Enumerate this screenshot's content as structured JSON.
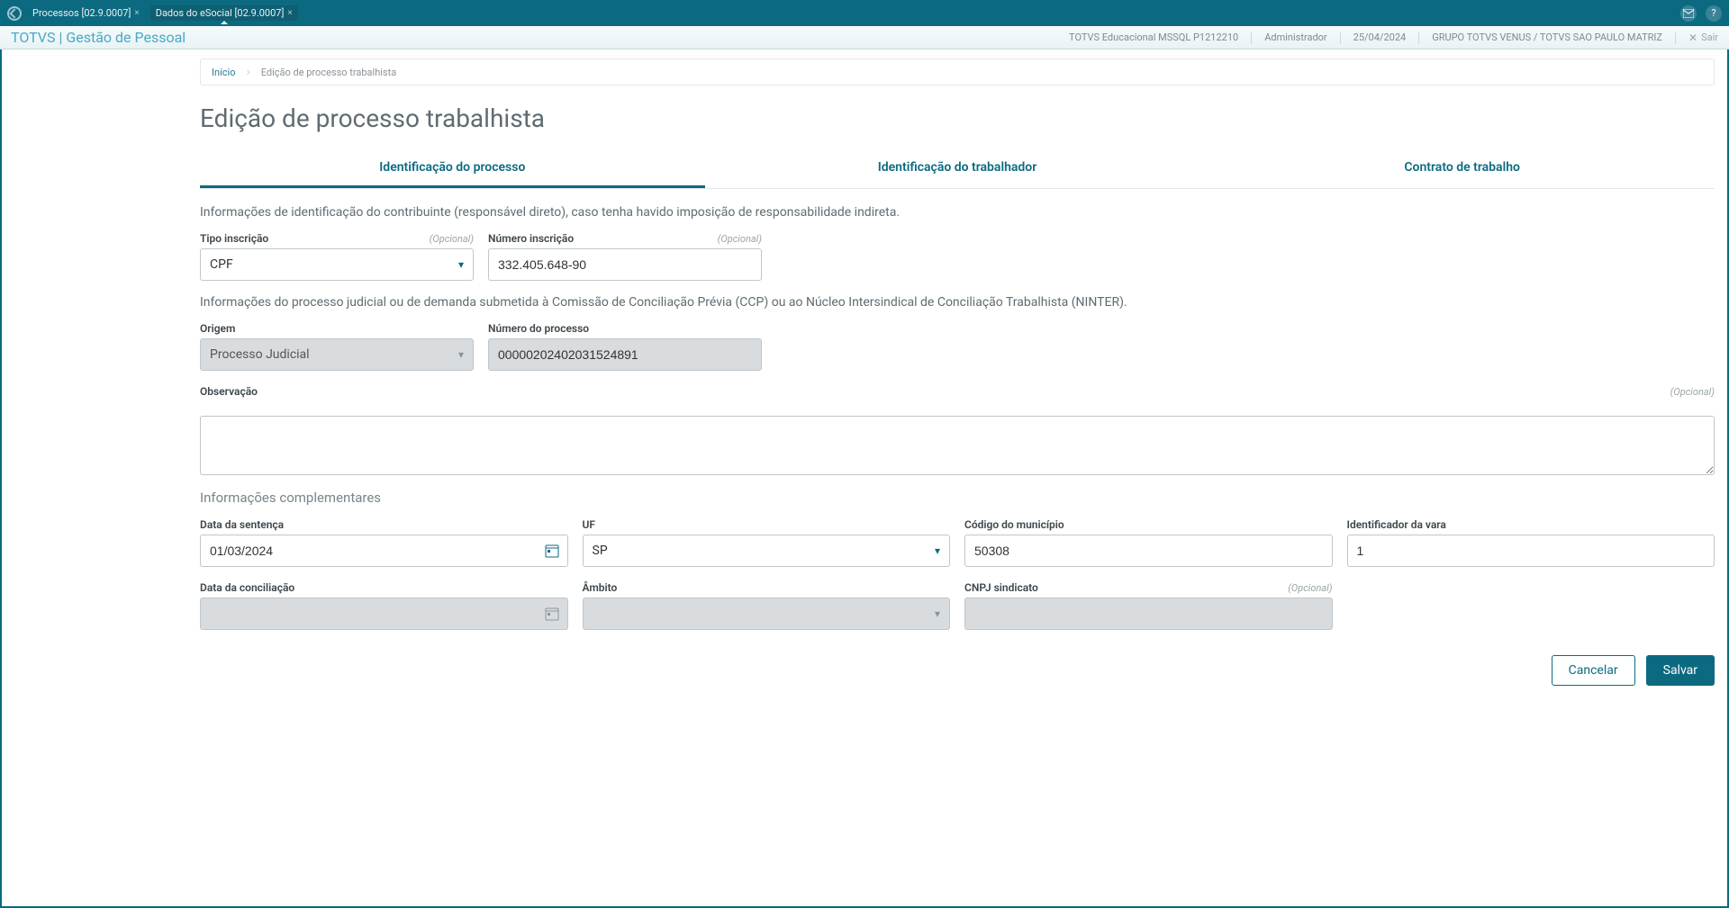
{
  "titlebar": {
    "tabs": [
      {
        "label": "Processos [02.9.0007]"
      },
      {
        "label": "Dados do eSocial [02.9.0007]"
      }
    ]
  },
  "subheader": {
    "title": "TOTVS | Gestão de Pessoal",
    "env": "TOTVS Educacional MSSQL P1212210",
    "user": "Administrador",
    "date": "25/04/2024",
    "group": "GRUPO TOTVS VENUS / TOTVS SAO PAULO MATRIZ",
    "exit": "Sair"
  },
  "breadcrumb": {
    "home": "Início",
    "current": "Edição de processo trabalhista"
  },
  "page_title": "Edição de processo trabalhista",
  "tabs": {
    "t1": "Identificação do processo",
    "t2": "Identificação do trabalhador",
    "t3": "Contrato de trabalho"
  },
  "section1_intro": "Informações de identificação do contribuinte (responsável direto), caso tenha havido imposição de responsabilidade indireta.",
  "labels": {
    "tipo_inscricao": "Tipo inscrição",
    "numero_inscricao": "Número inscrição",
    "optional": "(Opcional)",
    "origem": "Origem",
    "numero_processo": "Número do processo",
    "observacao": "Observação",
    "data_sentenca": "Data da sentença",
    "uf": "UF",
    "codigo_municipio": "Código do município",
    "identificador_vara": "Identificador da vara",
    "data_conciliacao": "Data da conciliação",
    "ambito": "Âmbito",
    "cnpj_sindicato": "CNPJ sindicato"
  },
  "values": {
    "tipo_inscricao": "CPF",
    "numero_inscricao": "332.405.648-90",
    "origem": "Processo Judicial",
    "numero_processo": "00000202402031524891",
    "observacao": "",
    "data_sentenca": "01/03/2024",
    "uf": "SP",
    "codigo_municipio": "50308",
    "identificador_vara": "1",
    "data_conciliacao": "",
    "ambito": "",
    "cnpj_sindicato": ""
  },
  "section2_intro": "Informações do processo judicial ou de demanda submetida à Comissão de Conciliação Prévia (CCP) ou ao Núcleo Intersindical de Conciliação Trabalhista (NINTER).",
  "section3_title": "Informações complementares",
  "footer": {
    "cancel": "Cancelar",
    "save": "Salvar"
  }
}
